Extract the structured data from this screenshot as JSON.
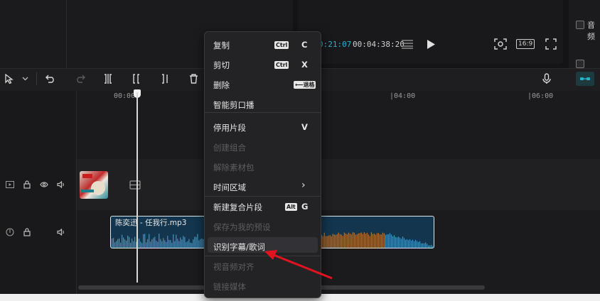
{
  "player": {
    "current_time": "0:21:07",
    "total_time": "00:04:38:20",
    "ratio": "16:9",
    "icons": [
      "list-icon",
      "play-icon",
      "screenshot-icon",
      "fullscreen-icon"
    ]
  },
  "side_panel": {
    "label": "音频"
  },
  "ruler": {
    "marks": [
      "00:00",
      "|04:00",
      "|06:00"
    ]
  },
  "audio_clip": {
    "name": "陈奕迅 - 任我行.mp3"
  },
  "context_menu": {
    "items": [
      {
        "label": "复制",
        "modifier": "Ctrl",
        "key": "C",
        "enabled": true
      },
      {
        "label": "剪切",
        "modifier": "Ctrl",
        "key": "X",
        "enabled": true
      },
      {
        "label": "删除",
        "modifier": "⟵退格",
        "key": "",
        "enabled": true
      },
      {
        "label": "智能剪口播",
        "modifier": "",
        "key": "",
        "enabled": true
      },
      {
        "label": "停用片段",
        "modifier": "",
        "key": "V",
        "enabled": true
      },
      {
        "label": "创建组合",
        "modifier": "",
        "key": "",
        "enabled": false
      },
      {
        "label": "解除素材包",
        "modifier": "",
        "key": "",
        "enabled": false
      },
      {
        "label": "时间区域",
        "modifier": "",
        "key": "›",
        "enabled": true
      },
      {
        "label": "新建复合片段",
        "modifier": "Alt",
        "key": "G",
        "enabled": true
      },
      {
        "label": "保存为我的预设",
        "modifier": "",
        "key": "",
        "enabled": false
      },
      {
        "label": "识别字幕/歌词",
        "modifier": "",
        "key": "",
        "enabled": true,
        "highlighted": true
      },
      {
        "label": "视音频对齐",
        "modifier": "",
        "key": "",
        "enabled": false
      },
      {
        "label": "链接媒体",
        "modifier": "",
        "key": "",
        "enabled": false
      }
    ]
  },
  "colors": {
    "accent": "#27b4c9",
    "annotation_arrow": "#e0141e",
    "audio_clip": "#13354d"
  }
}
